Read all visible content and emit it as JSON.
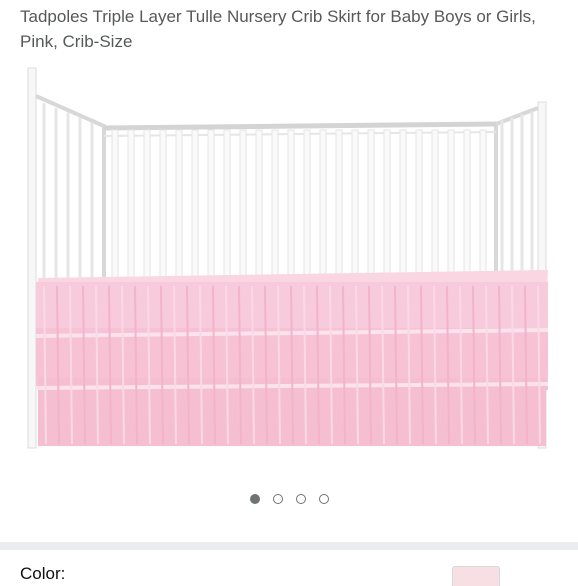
{
  "product": {
    "title": "Tadpoles Triple Layer Tulle Nursery Crib Skirt for Baby Boys or Girls, Pink, Crib-Size"
  },
  "icons": {
    "share": "share-icon"
  },
  "carousel": {
    "image_count": 4,
    "active_index": 0
  },
  "variation": {
    "color_label": "Color:"
  },
  "colors": {
    "text": "#565959",
    "skirt_pink": "#f6c6d6",
    "dot": "#6f7373",
    "divider": "#eaeded"
  }
}
